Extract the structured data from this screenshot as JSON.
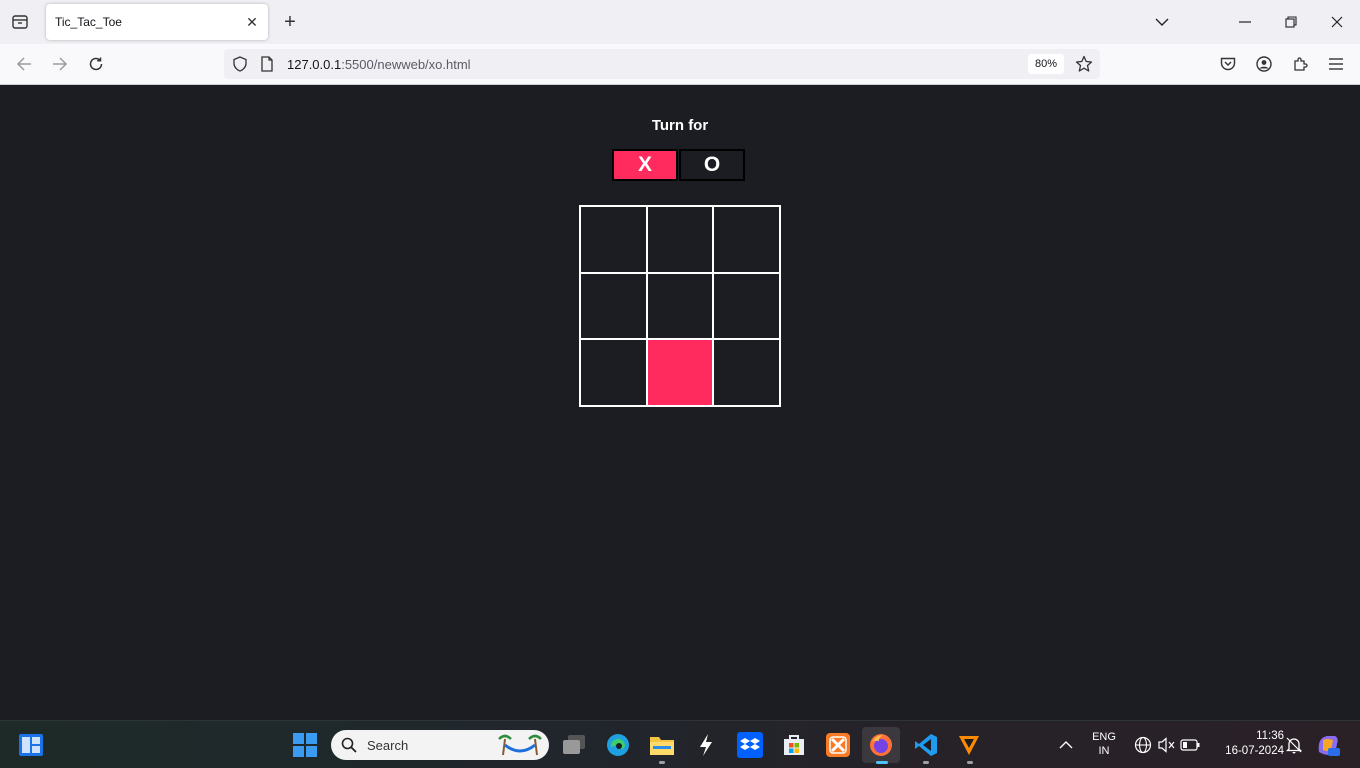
{
  "browser": {
    "tab_title": "Tic_Tac_Toe",
    "url_host": "127.0.0.1",
    "url_rest": ":5500/newweb/xo.html",
    "zoom": "80%"
  },
  "game": {
    "turn_label": "Turn for",
    "player_x": "X",
    "player_o": "O",
    "active_player": "X",
    "highlight_color": "#ff2a5e",
    "board": [
      "",
      "",
      "",
      "",
      "",
      "",
      "",
      "",
      ""
    ],
    "highlighted_cell_index": 7
  },
  "taskbar": {
    "search_placeholder": "Search",
    "lang_primary": "ENG",
    "lang_secondary": "IN",
    "time": "11:36",
    "date": "16-07-2024"
  }
}
